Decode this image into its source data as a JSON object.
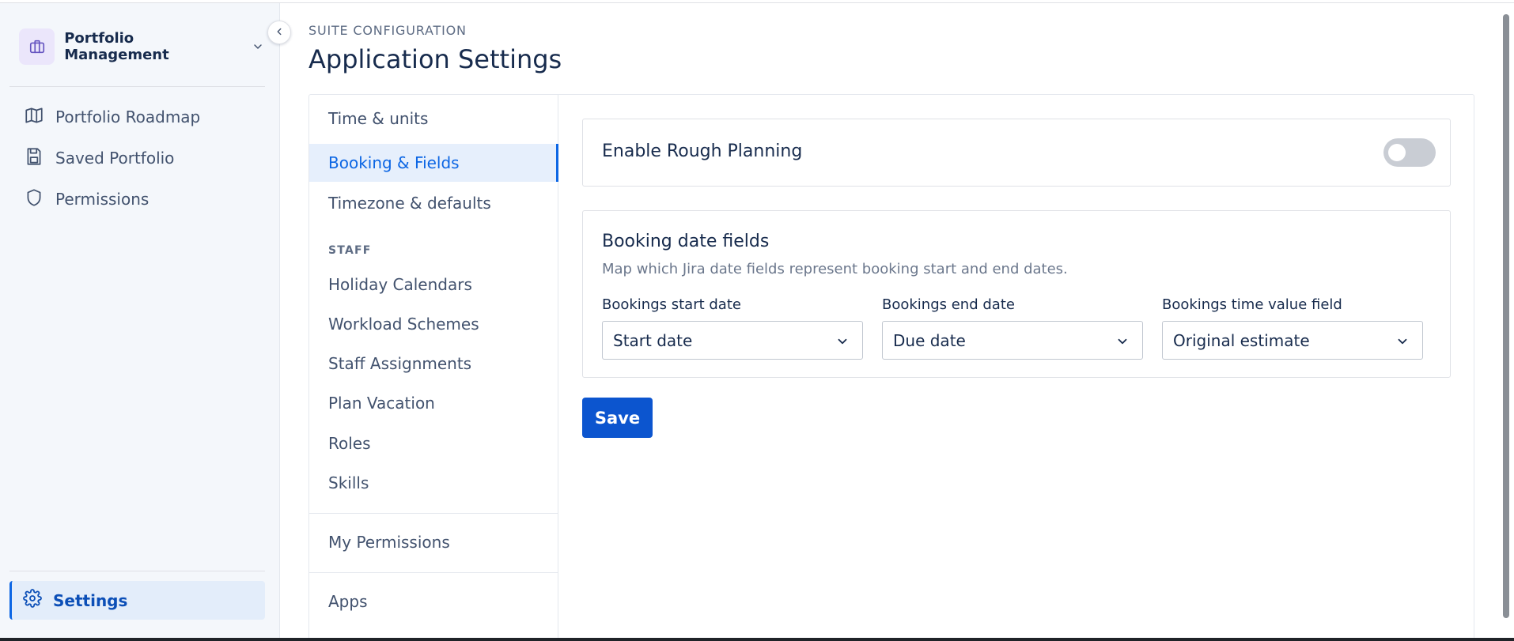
{
  "sidebar": {
    "project_name": "Portfolio Management",
    "items": [
      {
        "label": "Portfolio Roadmap",
        "icon": "map-icon"
      },
      {
        "label": "Saved Portfolio",
        "icon": "save-icon"
      },
      {
        "label": "Permissions",
        "icon": "shield-icon"
      }
    ],
    "settings_label": "Settings"
  },
  "header": {
    "kicker": "SUITE CONFIGURATION",
    "title": "Application Settings"
  },
  "subnav": {
    "items": [
      {
        "label": "Time & units"
      },
      {
        "label": "Booking & Fields",
        "active": true
      },
      {
        "label": "Timezone & defaults"
      }
    ],
    "staff_section": "STAFF",
    "staff_items": [
      {
        "label": "Holiday Calendars"
      },
      {
        "label": "Workload Schemes"
      },
      {
        "label": "Staff Assignments"
      },
      {
        "label": "Plan Vacation"
      },
      {
        "label": "Roles"
      },
      {
        "label": "Skills"
      }
    ],
    "my_permissions": "My Permissions",
    "apps": "Apps"
  },
  "rough_planning": {
    "label": "Enable Rough Planning",
    "enabled": false
  },
  "booking_dates": {
    "title": "Booking date fields",
    "description": "Map which Jira date fields represent booking start and end dates.",
    "fields": [
      {
        "label": "Bookings start date",
        "value": "Start date"
      },
      {
        "label": "Bookings end date",
        "value": "Due date"
      },
      {
        "label": "Bookings time value field",
        "value": "Original estimate"
      }
    ]
  },
  "actions": {
    "save_label": "Save"
  },
  "colors": {
    "accent": "#0c66e4",
    "button": "#0c55cf",
    "toggle_off": "#c9cdd4"
  }
}
